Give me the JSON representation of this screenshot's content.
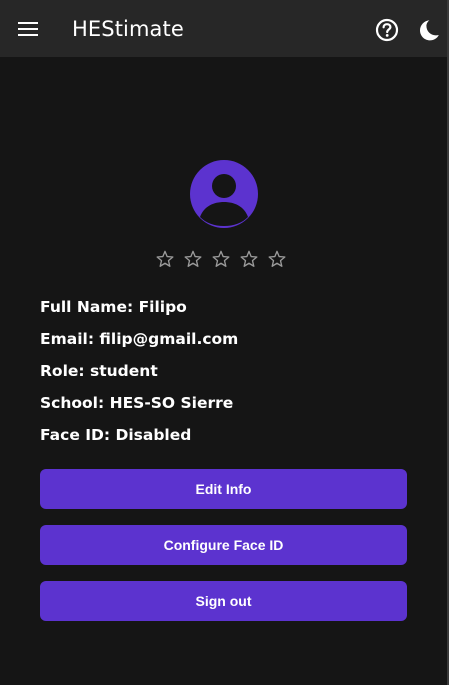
{
  "appbar": {
    "title": "HEStimate",
    "menu_icon": "hamburger-menu-icon",
    "help_icon": "help-circle-icon",
    "theme_icon": "moon-icon"
  },
  "profile": {
    "avatar_icon": "user-avatar-icon",
    "rating": {
      "max": 5,
      "value": 0
    },
    "full_name": "Full Name: Filipo",
    "email": "Email: filip@gmail.com",
    "role": "Role: student",
    "school": "School: HES-SO Sierre",
    "face_id": "Face ID: Disabled"
  },
  "actions": {
    "edit_info": "Edit Info",
    "configure_face_id": "Configure Face ID",
    "sign_out": "Sign out"
  },
  "colors": {
    "accent": "#5c33cf",
    "background": "#151515",
    "appbar": "#272727"
  }
}
